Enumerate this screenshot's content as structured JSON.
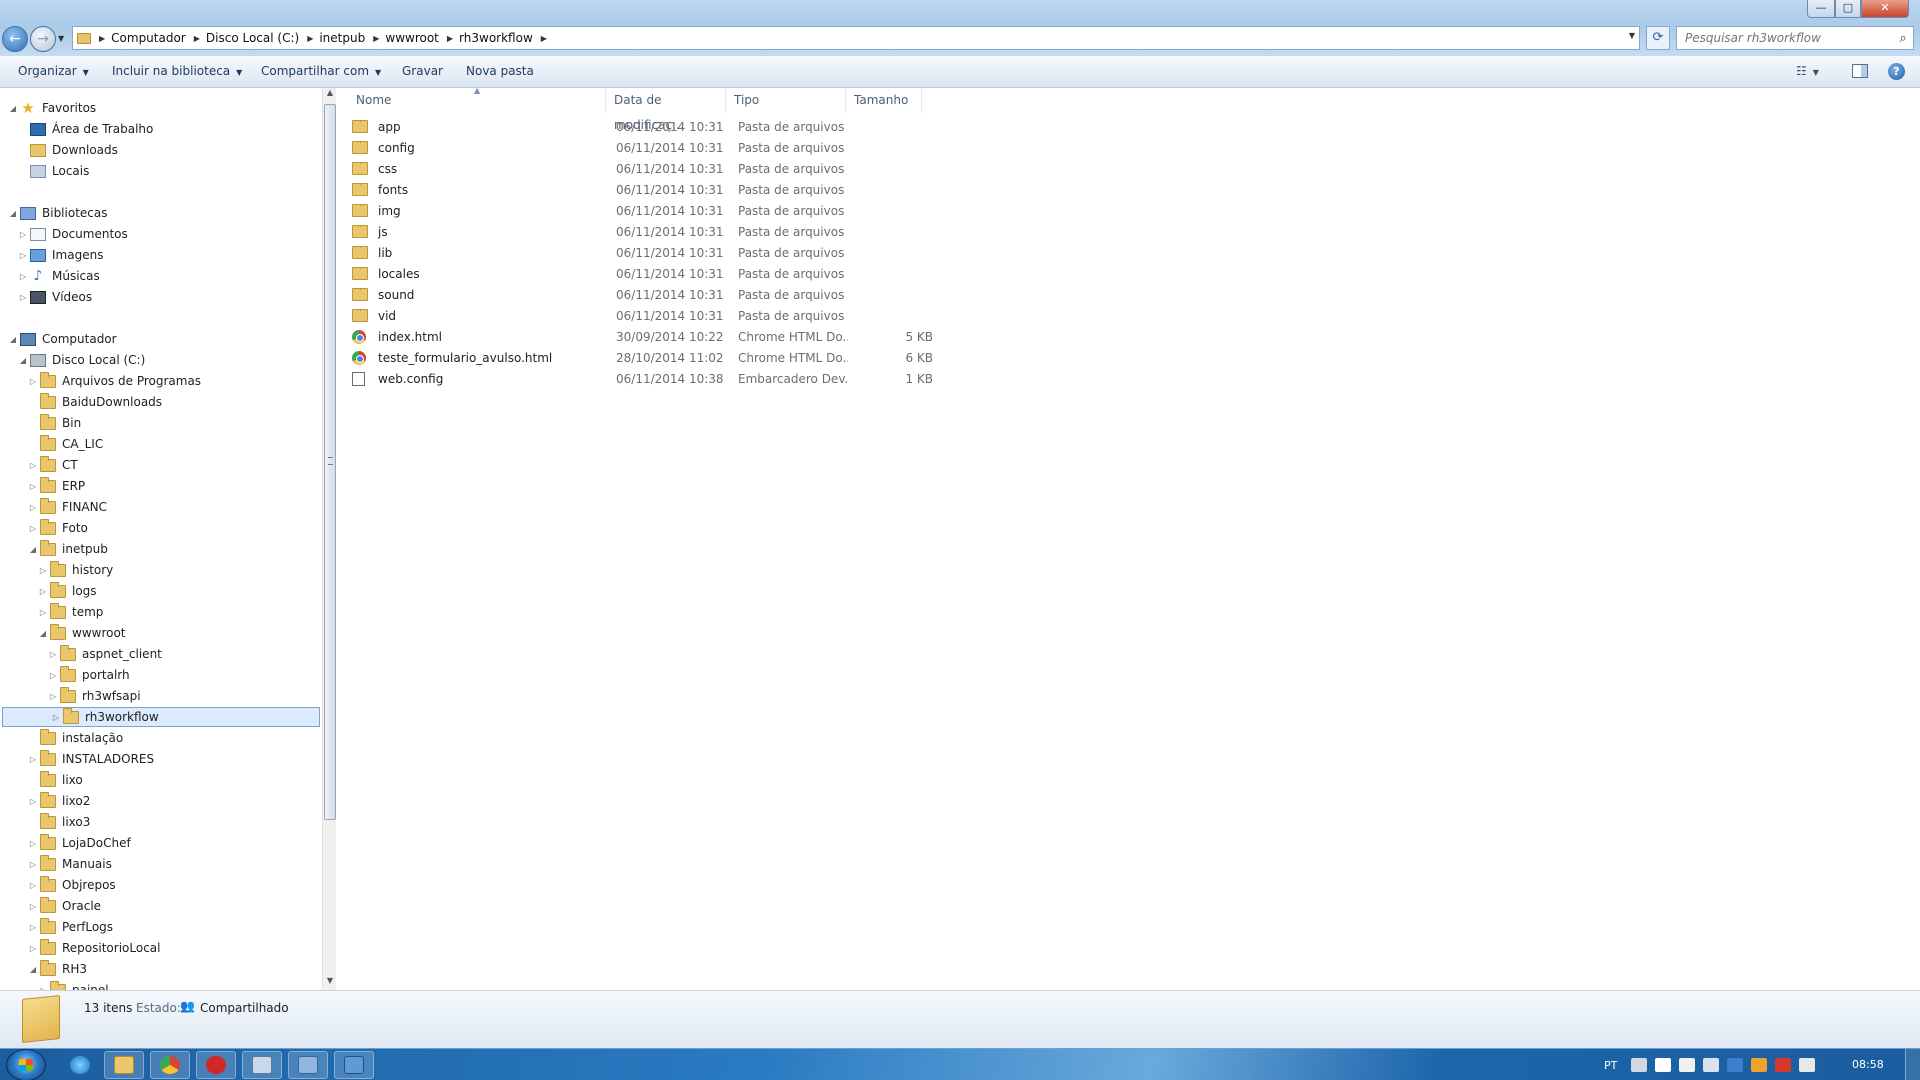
{
  "window": {
    "minimize_glyph": "—",
    "maximize_glyph": "□",
    "close_glyph": "✕"
  },
  "address": {
    "breadcrumbs": [
      "Computador",
      "Disco Local (C:)",
      "inetpub",
      "wwwroot",
      "rh3workflow"
    ],
    "search_placeholder": "Pesquisar rh3workflow"
  },
  "toolbar": {
    "organize": "Organizar",
    "include_library": "Incluir na biblioteca",
    "share_with": "Compartilhar com",
    "burn": "Gravar",
    "new_folder": "Nova pasta"
  },
  "nav": {
    "favorites": {
      "label": "Favoritos",
      "items": [
        "Área de Trabalho",
        "Downloads",
        "Locais"
      ]
    },
    "libraries": {
      "label": "Bibliotecas",
      "items": [
        "Documentos",
        "Imagens",
        "Músicas",
        "Vídeos"
      ]
    },
    "computer": {
      "label": "Computador",
      "drive": "Disco Local (C:)",
      "folders_a": [
        "Arquivos de Programas",
        "BaiduDownloads",
        "Bin",
        "CA_LIC",
        "CT",
        "ERP",
        "FINANC",
        "Foto",
        "inetpub"
      ],
      "inetpub_children": [
        "history",
        "logs",
        "temp",
        "wwwroot"
      ],
      "wwwroot_children": [
        "aspnet_client",
        "portalrh",
        "rh3wfsapi",
        "rh3workflow"
      ],
      "folders_b": [
        "instalação",
        "INSTALADORES",
        "lixo",
        "lixo2",
        "lixo3",
        "LojaDoChef",
        "Manuais",
        "Objrepos",
        "Oracle",
        "PerfLogs",
        "RepositorioLocal",
        "RH3"
      ],
      "rh3_children": [
        "painel"
      ]
    }
  },
  "columns": {
    "name": "Nome",
    "date": "Data de modificaç...",
    "type": "Tipo",
    "size": "Tamanho"
  },
  "files": [
    {
      "name": "app",
      "date": "06/11/2014 10:31",
      "type": "Pasta de arquivos",
      "size": "",
      "icon": "folder"
    },
    {
      "name": "config",
      "date": "06/11/2014 10:31",
      "type": "Pasta de arquivos",
      "size": "",
      "icon": "folder"
    },
    {
      "name": "css",
      "date": "06/11/2014 10:31",
      "type": "Pasta de arquivos",
      "size": "",
      "icon": "folder"
    },
    {
      "name": "fonts",
      "date": "06/11/2014 10:31",
      "type": "Pasta de arquivos",
      "size": "",
      "icon": "folder"
    },
    {
      "name": "img",
      "date": "06/11/2014 10:31",
      "type": "Pasta de arquivos",
      "size": "",
      "icon": "folder"
    },
    {
      "name": "js",
      "date": "06/11/2014 10:31",
      "type": "Pasta de arquivos",
      "size": "",
      "icon": "folder"
    },
    {
      "name": "lib",
      "date": "06/11/2014 10:31",
      "type": "Pasta de arquivos",
      "size": "",
      "icon": "folder"
    },
    {
      "name": "locales",
      "date": "06/11/2014 10:31",
      "type": "Pasta de arquivos",
      "size": "",
      "icon": "folder"
    },
    {
      "name": "sound",
      "date": "06/11/2014 10:31",
      "type": "Pasta de arquivos",
      "size": "",
      "icon": "folder"
    },
    {
      "name": "vid",
      "date": "06/11/2014 10:31",
      "type": "Pasta de arquivos",
      "size": "",
      "icon": "folder"
    },
    {
      "name": "index.html",
      "date": "30/09/2014 10:22",
      "type": "Chrome HTML Do...",
      "size": "5 KB",
      "icon": "chrome"
    },
    {
      "name": "teste_formulario_avulso.html",
      "date": "28/10/2014 11:02",
      "type": "Chrome HTML Do...",
      "size": "6 KB",
      "icon": "chrome"
    },
    {
      "name": "web.config",
      "date": "06/11/2014 10:38",
      "type": "Embarcadero Dev...",
      "size": "1 KB",
      "icon": "config"
    }
  ],
  "details": {
    "item_count": "13 itens",
    "state_label": "Estado:",
    "state_value": "Compartilhado"
  },
  "taskbar": {
    "apps": [
      "internet-explorer",
      "windows-explorer",
      "google-chrome",
      "red-app",
      "remote-app",
      "network-app",
      "tool-app"
    ],
    "language": "PT",
    "clock": "08:58"
  },
  "colors": {
    "selection": "#dbeafc",
    "folder": "#eac66d",
    "accent": "#1e395b"
  }
}
